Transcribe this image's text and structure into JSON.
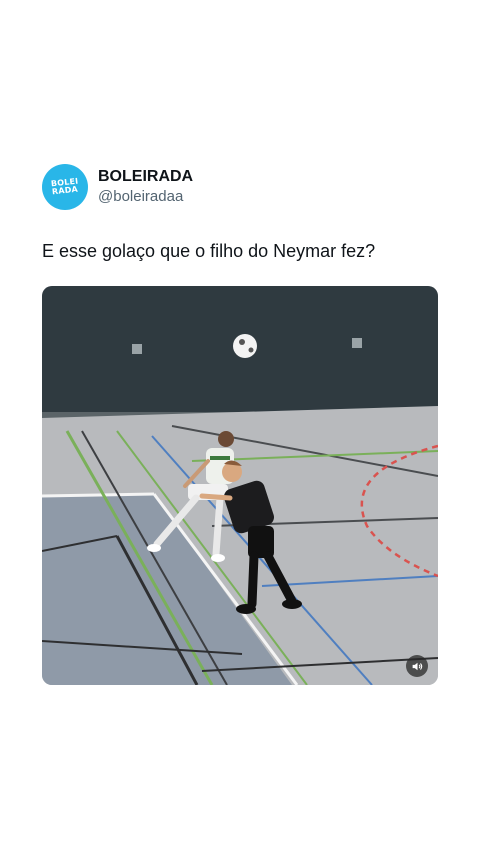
{
  "author": {
    "display_name": "BOLEIRADA",
    "handle": "@boleiradaa",
    "avatar_text_line1": "BOLEI",
    "avatar_text_line2": "RADA",
    "avatar_color": "#29b6e8"
  },
  "tweet": {
    "text": "E esse golaço que o filho do Neymar fez?"
  },
  "media": {
    "type": "video",
    "description_icon": "volume-icon"
  },
  "colors": {
    "text_primary": "#0f1419",
    "text_secondary": "#536471"
  }
}
